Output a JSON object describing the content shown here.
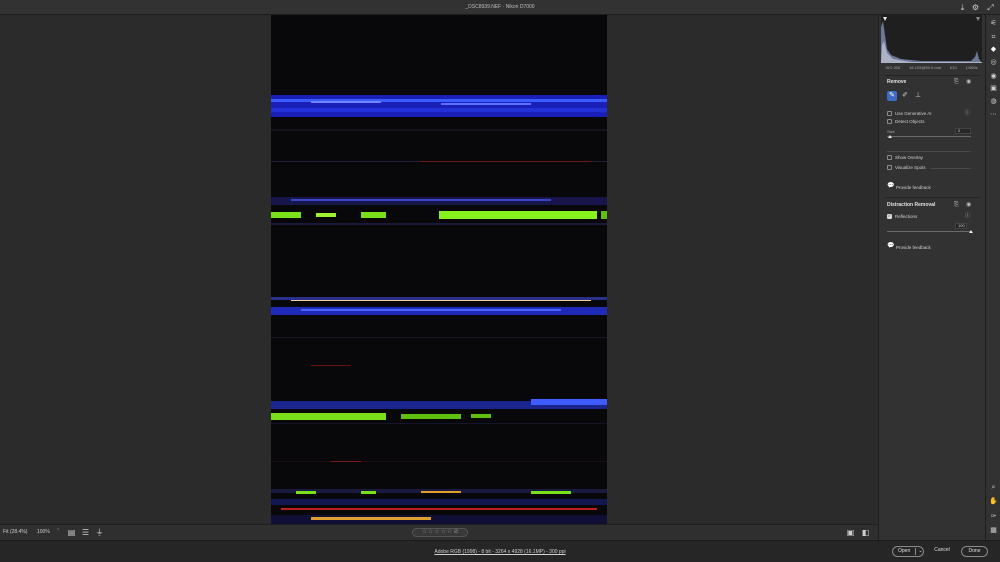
{
  "window": {
    "title": "_DSC8939.NEF  ·  Nikon D7000"
  },
  "histogram": {
    "meta": [
      "ISO 200",
      "18-105@50.0 mm",
      "f/10",
      "1/400s"
    ]
  },
  "remove_panel": {
    "title": "Remove",
    "use_generative_ai": {
      "label": "Use Generative AI",
      "checked": false
    },
    "detect_objects": {
      "label": "Detect Objects",
      "checked": false
    },
    "size": {
      "label": "Size",
      "value": "0"
    },
    "show_overlay": {
      "label": "Show Overlay",
      "checked": false
    },
    "visualize_spots": {
      "label": "Visualize Spots",
      "checked": false
    },
    "feedback": "Provide feedback"
  },
  "distraction_panel": {
    "title": "Distraction Removal",
    "reflections": {
      "label": "Reflections",
      "checked": true,
      "value": "100"
    },
    "feedback": "Provide feedback"
  },
  "bottom_toolbar": {
    "zoom_fit": "Fit (28.4%)",
    "zoom_100": "100%",
    "rating_stars": [
      "☆",
      "☆",
      "☆",
      "☆",
      "☆"
    ]
  },
  "status_bar": {
    "workflow": "Adobe RGB (1998) - 8 bit - 3264 x 4928 (16.1MP) - 300 ppi",
    "open_label": "Open",
    "cancel_label": "Cancel",
    "done_label": "Done"
  },
  "icons": {
    "title_save": "save-icon",
    "title_settings": "gear-icon",
    "title_expand": "expand-icon"
  }
}
